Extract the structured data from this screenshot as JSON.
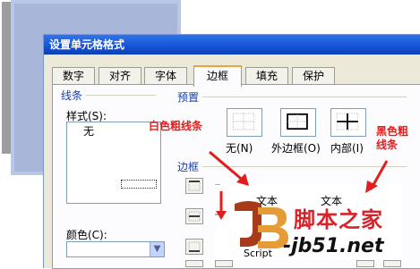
{
  "dialog": {
    "title": "设置单元格格式",
    "tabs": [
      "数字",
      "对齐",
      "字体",
      "边框",
      "填充",
      "保护"
    ],
    "active_tab": "边框"
  },
  "line_group": {
    "title": "线条",
    "style_label": "样式(S):",
    "none_label": "无",
    "color_label": "颜色(C):"
  },
  "presets": {
    "title": "预置",
    "none": "无(N)",
    "outline": "外边框(O)",
    "inside": "内部(I)"
  },
  "border_group": {
    "title": "边框"
  },
  "preview": {
    "text_left": "文本",
    "text_right": "文本"
  },
  "annotations": {
    "left": "白色粗线条",
    "right_line1": "黑色粗",
    "right_line2": "线条"
  },
  "watermark": {
    "chinese": "脚本之家",
    "url": "-jb51.net",
    "script": "Script"
  },
  "colors": {
    "title_blue": "#1453d6",
    "annotation_red": "#e21d1d",
    "tab_highlight": "#f3a13a"
  }
}
